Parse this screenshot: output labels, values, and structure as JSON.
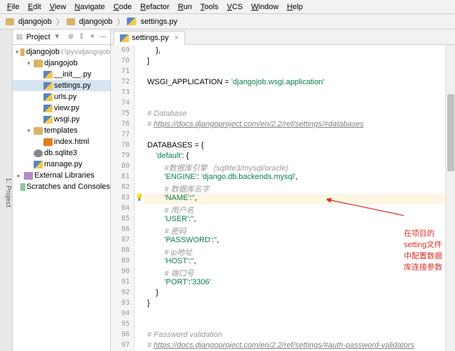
{
  "menu": [
    "File",
    "Edit",
    "View",
    "Navigate",
    "Code",
    "Refactor",
    "Run",
    "Tools",
    "VCS",
    "Window",
    "Help"
  ],
  "breadcrumbs": [
    "djangojob",
    "djangojob",
    "settings.py"
  ],
  "side_tab": "1: Project",
  "project_label": "Project",
  "tree": [
    {
      "d": 1,
      "tw": "▾",
      "ico": "dir",
      "name": "djangojob",
      "hint": "I:\\pys\\djangojob"
    },
    {
      "d": 2,
      "tw": "▾",
      "ico": "dir",
      "name": "djangojob",
      "hint": ""
    },
    {
      "d": 3,
      "tw": "",
      "ico": "py",
      "name": "__init__.py",
      "hint": ""
    },
    {
      "d": 3,
      "tw": "",
      "ico": "py",
      "name": "settings.py",
      "hint": "",
      "sel": true
    },
    {
      "d": 3,
      "tw": "",
      "ico": "py",
      "name": "urls.py",
      "hint": ""
    },
    {
      "d": 3,
      "tw": "",
      "ico": "py",
      "name": "view.py",
      "hint": ""
    },
    {
      "d": 3,
      "tw": "",
      "ico": "py",
      "name": "wsgi.py",
      "hint": ""
    },
    {
      "d": 2,
      "tw": "▾",
      "ico": "dir",
      "name": "templates",
      "hint": ""
    },
    {
      "d": 3,
      "tw": "",
      "ico": "html",
      "name": "index.html",
      "hint": ""
    },
    {
      "d": 2,
      "tw": "",
      "ico": "db",
      "name": "db.sqlite3",
      "hint": ""
    },
    {
      "d": 2,
      "tw": "",
      "ico": "py",
      "name": "manage.py",
      "hint": ""
    },
    {
      "d": 1,
      "tw": "▸",
      "ico": "lib",
      "name": "External Libraries",
      "hint": ""
    },
    {
      "d": 1,
      "tw": "",
      "ico": "scr",
      "name": "Scratches and Consoles",
      "hint": ""
    }
  ],
  "tab_name": "settings.py",
  "line_start": 69,
  "lines": [
    {
      "html": "    },"
    },
    {
      "html": "]"
    },
    {
      "html": ""
    },
    {
      "html": "WSGI_APPLICATION = <span class='str'>'djangojob.wsgi.application'</span>"
    },
    {
      "html": ""
    },
    {
      "html": ""
    },
    {
      "html": "<span class='cmt'># Database</span>"
    },
    {
      "html": "<span class='cmt'># </span><span class='url'>https://docs.djangoproject.com/en/2.2/ref/settings/#databases</span>"
    },
    {
      "html": ""
    },
    {
      "html": "DATABASES = {"
    },
    {
      "html": "    <span class='str'>'default'</span>: {"
    },
    {
      "html": "        <span class='cmt'>#数据库引擎   (sqllite3/mysql/oracle)</span>"
    },
    {
      "html": "        <span class='str'>'ENGINE'</span>: <span class='str'>'django.db.backends.mysql'</span>,"
    },
    {
      "html": "        <span class='cmt'># 数据库名字</span>"
    },
    {
      "html": "        <span class='str'>'NAME'</span>:<span class='str'>''</span>,",
      "hl": true,
      "mark": "bulb"
    },
    {
      "html": "        <span class='cmt'># 用户名</span>"
    },
    {
      "html": "        <span class='str'>'USER'</span>:<span class='str'>''</span>,"
    },
    {
      "html": "        <span class='cmt'># 密码</span>"
    },
    {
      "html": "        <span class='str'>'PASSWORD'</span>:<span class='str'>''</span>,"
    },
    {
      "html": "        <span class='cmt'># ip地址</span>"
    },
    {
      "html": "        <span class='str'>'HOST'</span>:<span class='str'>''</span>,"
    },
    {
      "html": "        <span class='cmt'># 端口号</span>"
    },
    {
      "html": "        <span class='str'>'PORT'</span>:<span class='str'>'3306'</span>"
    },
    {
      "html": "    }"
    },
    {
      "html": "}"
    },
    {
      "html": ""
    },
    {
      "html": ""
    },
    {
      "html": "<span class='cmt'># Password validation</span>"
    },
    {
      "html": "<span class='cmt'># </span><span class='url'>https://docs.djangoproject.com/en/2.2/ref/settings/#auth-password-validators</span>"
    }
  ],
  "annotation": "在项目的setting文件中配置数据库连接参数"
}
